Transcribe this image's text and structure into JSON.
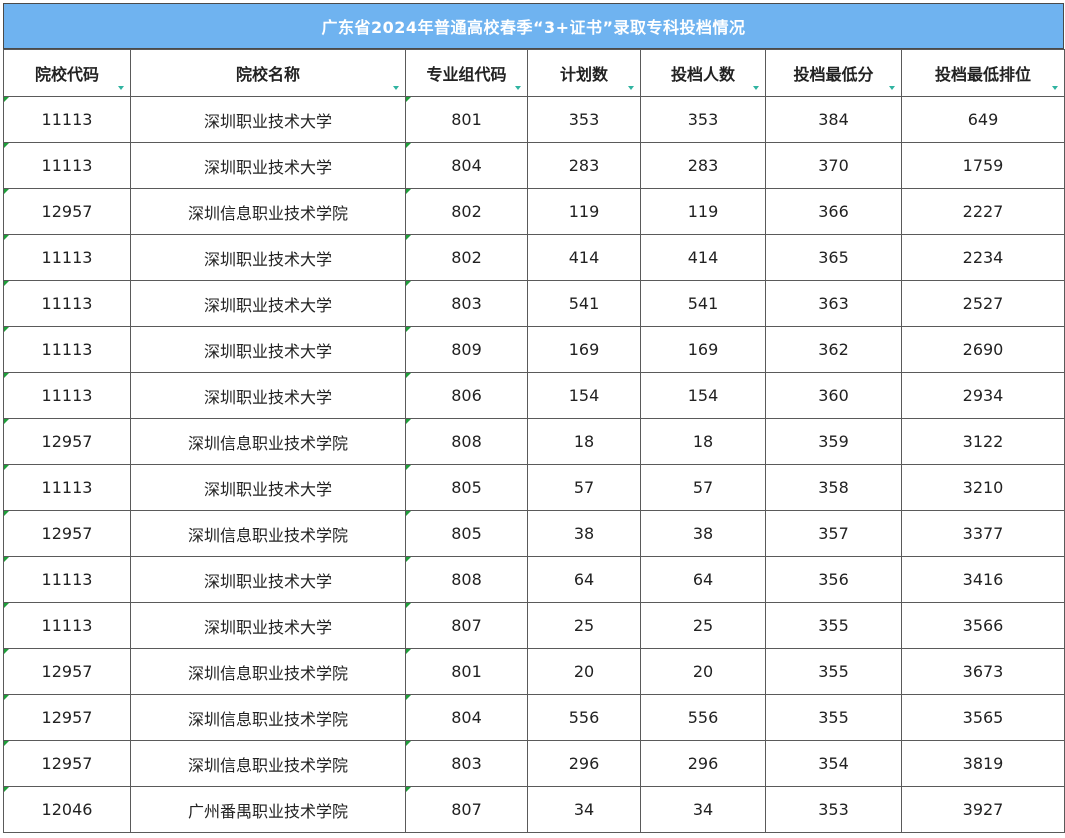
{
  "title": "广东省2024年普通高校春季“3+证书”录取专科投档情况",
  "columns": [
    "院校代码",
    "院校名称",
    "专业组代码",
    "计划数",
    "投档人数",
    "投档最低分",
    "投档最低排位"
  ],
  "rows": [
    [
      "11113",
      "深圳职业技术大学",
      "801",
      "353",
      "353",
      "384",
      "649"
    ],
    [
      "11113",
      "深圳职业技术大学",
      "804",
      "283",
      "283",
      "370",
      "1759"
    ],
    [
      "12957",
      "深圳信息职业技术学院",
      "802",
      "119",
      "119",
      "366",
      "2227"
    ],
    [
      "11113",
      "深圳职业技术大学",
      "802",
      "414",
      "414",
      "365",
      "2234"
    ],
    [
      "11113",
      "深圳职业技术大学",
      "803",
      "541",
      "541",
      "363",
      "2527"
    ],
    [
      "11113",
      "深圳职业技术大学",
      "809",
      "169",
      "169",
      "362",
      "2690"
    ],
    [
      "11113",
      "深圳职业技术大学",
      "806",
      "154",
      "154",
      "360",
      "2934"
    ],
    [
      "12957",
      "深圳信息职业技术学院",
      "808",
      "18",
      "18",
      "359",
      "3122"
    ],
    [
      "11113",
      "深圳职业技术大学",
      "805",
      "57",
      "57",
      "358",
      "3210"
    ],
    [
      "12957",
      "深圳信息职业技术学院",
      "805",
      "38",
      "38",
      "357",
      "3377"
    ],
    [
      "11113",
      "深圳职业技术大学",
      "808",
      "64",
      "64",
      "356",
      "3416"
    ],
    [
      "11113",
      "深圳职业技术大学",
      "807",
      "25",
      "25",
      "355",
      "3566"
    ],
    [
      "12957",
      "深圳信息职业技术学院",
      "801",
      "20",
      "20",
      "355",
      "3673"
    ],
    [
      "12957",
      "深圳信息职业技术学院",
      "804",
      "556",
      "556",
      "355",
      "3565"
    ],
    [
      "12957",
      "深圳信息职业技术学院",
      "803",
      "296",
      "296",
      "354",
      "3819"
    ],
    [
      "12046",
      "广州番禺职业技术学院",
      "807",
      "34",
      "34",
      "353",
      "3927"
    ]
  ],
  "colors": {
    "title_bg": "#6fb3f0",
    "filter_arrow": "#2fb3a0",
    "corner_mark": "#1e9e3a"
  }
}
